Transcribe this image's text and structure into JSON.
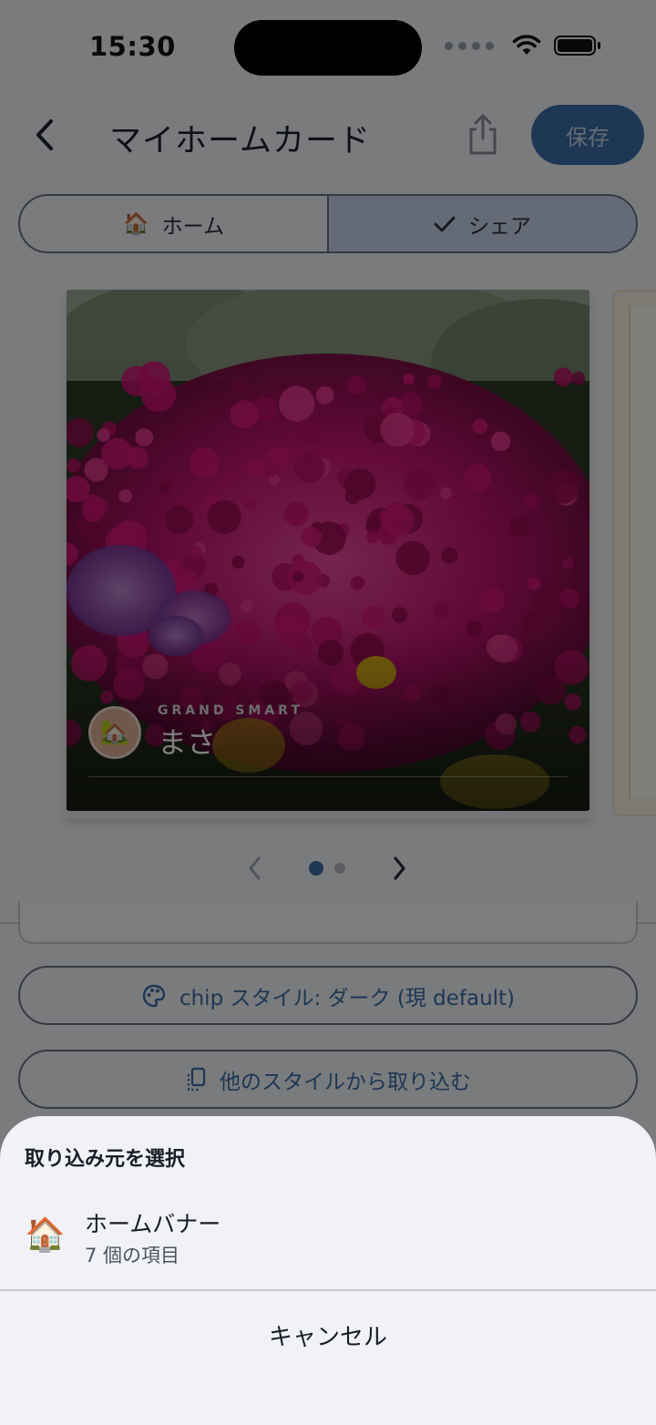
{
  "status_bar": {
    "time": "15:30"
  },
  "nav": {
    "title": "マイホームカード",
    "save_label": "保存"
  },
  "segmented": {
    "home_label": "ホーム",
    "share_label": "シェア",
    "home_emoji": "🏠"
  },
  "card": {
    "brand": "GRAND SMART",
    "name": "まさ",
    "avatar_emoji": "🏡"
  },
  "pager": {
    "current_page": 1,
    "page_count": 2
  },
  "buttons": {
    "chip_style": "chip スタイル: ダーク (現 default)",
    "import_style": "他のスタイルから取り込む"
  },
  "sheet": {
    "title": "取り込み元を選択",
    "items": [
      {
        "icon_emoji": "🏠",
        "title": "ホームバナー",
        "subtitle": "7 個の項目"
      }
    ],
    "cancel_label": "キャンセル"
  },
  "colors": {
    "accent": "#3b6ea8",
    "segment_active": "#c8d6ec",
    "sheet_bg": "#f0f2f8"
  },
  "icons": [
    "chevron-left-icon",
    "share-icon",
    "checkmark-icon",
    "palette-icon",
    "copy-icon",
    "wifi-icon",
    "battery-icon"
  ]
}
